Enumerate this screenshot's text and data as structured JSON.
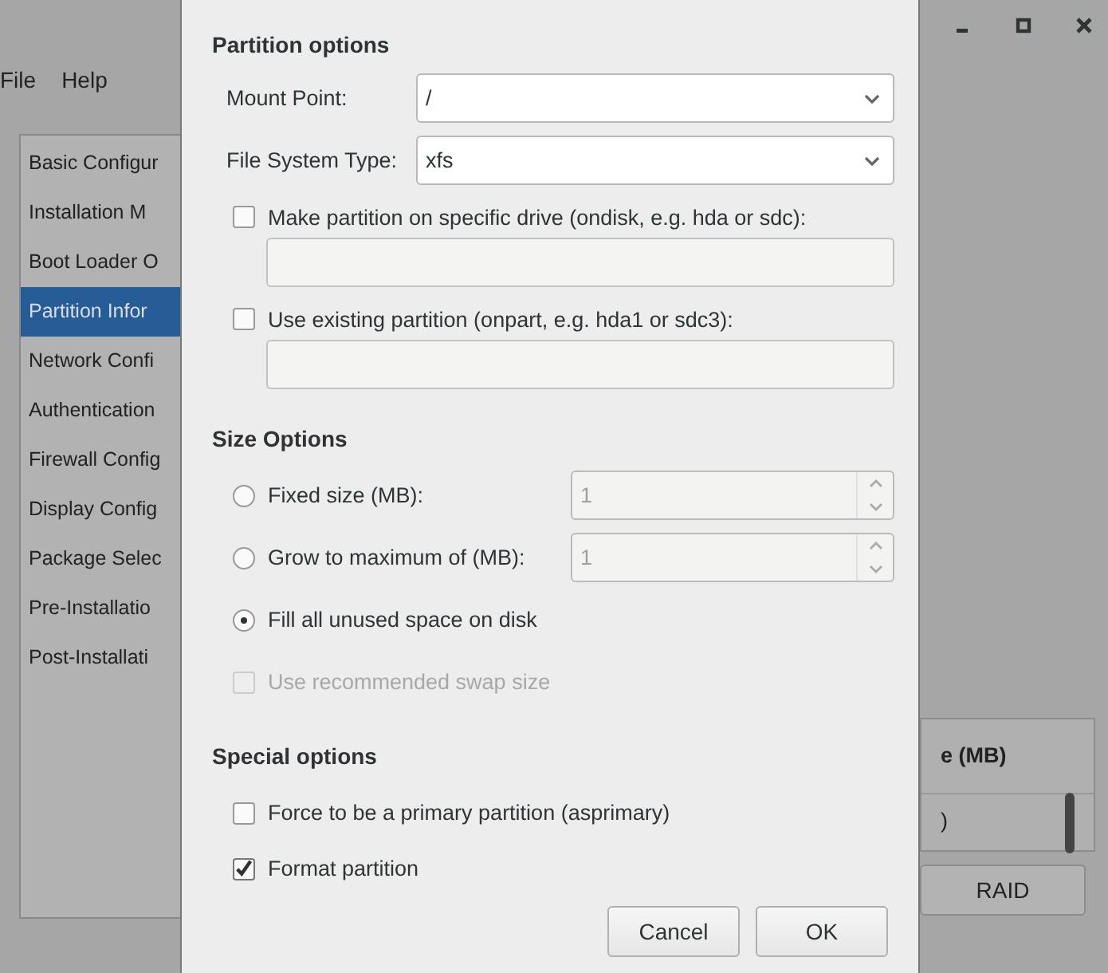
{
  "menu": [
    "File",
    "Help"
  ],
  "sidebar": {
    "items": [
      {
        "label": "Basic Configur",
        "selected": false
      },
      {
        "label": "Installation M",
        "selected": false
      },
      {
        "label": "Boot Loader O",
        "selected": false
      },
      {
        "label": "Partition Infor",
        "selected": true
      },
      {
        "label": "Network Confi",
        "selected": false
      },
      {
        "label": "Authentication",
        "selected": false
      },
      {
        "label": "Firewall Config",
        "selected": false
      },
      {
        "label": "Display Config",
        "selected": false
      },
      {
        "label": "Package Selec",
        "selected": false
      },
      {
        "label": "Pre-Installatio",
        "selected": false
      },
      {
        "label": "Post-Installati",
        "selected": false
      }
    ]
  },
  "background_table": {
    "header": "e (MB)",
    "cell": ")"
  },
  "raid_button": "RAID",
  "dialog": {
    "partition_options": {
      "title": "Partition options",
      "mount_point": {
        "label": "Mount Point:",
        "value": "/"
      },
      "file_system_type": {
        "label": "File System Type:",
        "value": "xfs"
      },
      "drive_options": [
        {
          "label": "Make partition on specific drive (ondisk, e.g. hda or sdc):",
          "checked": false
        },
        {
          "label": "Use existing partition (onpart, e.g. hda1 or sdc3):",
          "checked": false
        }
      ]
    },
    "size_options": {
      "title": "Size Options",
      "items": [
        {
          "kind": "radio",
          "label": "Fixed size (MB):",
          "selected": false,
          "spin": {
            "value": "1",
            "disabled": true
          }
        },
        {
          "kind": "radio",
          "label": "Grow to maximum of (MB):",
          "selected": false,
          "spin": {
            "value": "1",
            "disabled": true
          }
        },
        {
          "kind": "radio",
          "label": "Fill all unused space on disk",
          "selected": true
        },
        {
          "kind": "checkbox",
          "label": "Use recommended swap size",
          "checked": false,
          "disabled": true
        }
      ]
    },
    "special_options": {
      "title": "Special options",
      "items": [
        {
          "label": "Force to be a primary partition (asprimary)",
          "checked": false
        },
        {
          "label": "Format partition",
          "checked": true
        }
      ]
    },
    "buttons": [
      "Cancel",
      "OK"
    ]
  }
}
